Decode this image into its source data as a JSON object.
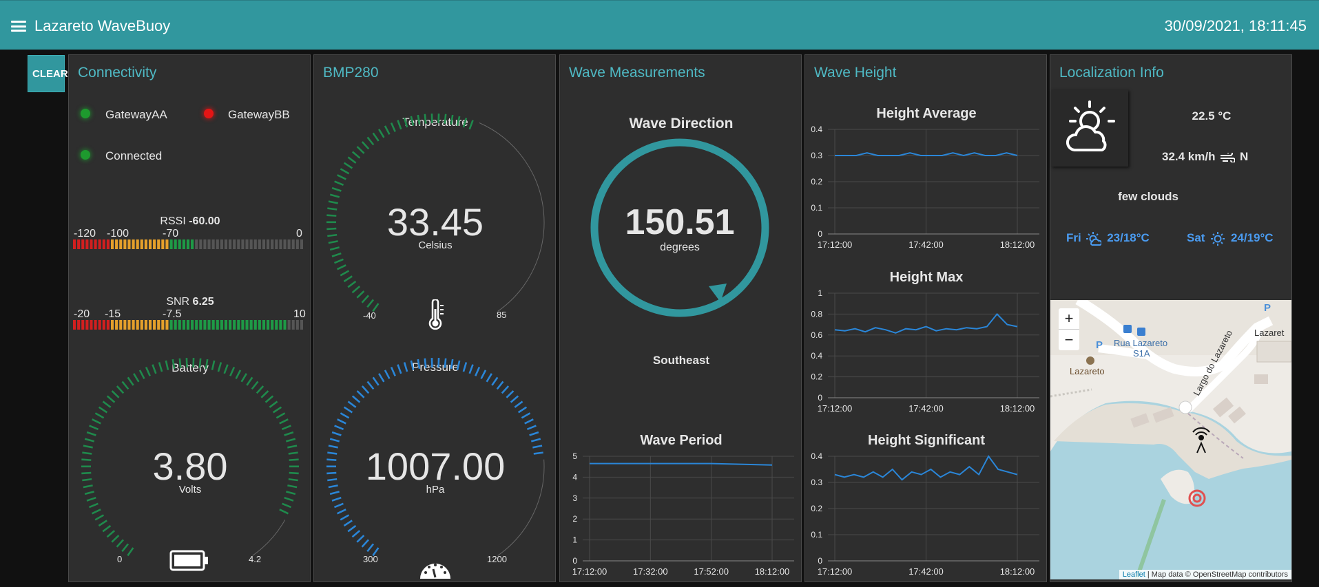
{
  "header": {
    "title": "Lazareto WaveBuoy",
    "datetime": "30/09/2021, 18:11:45"
  },
  "clear_button": "CLEAR",
  "connectivity": {
    "title": "Connectivity",
    "gateways": [
      {
        "name": "GatewayAA",
        "status_color": "#1e9a2e"
      },
      {
        "name": "GatewayBB",
        "status_color": "#e41515"
      },
      {
        "name": "Connected",
        "status_color": "#1e9a2e"
      }
    ],
    "rssi": {
      "label": "RSSI",
      "value": "-60.00",
      "ticks": [
        "-120",
        "-100",
        "-70",
        "0"
      ]
    },
    "snr": {
      "label": "SNR",
      "value": "6.25",
      "ticks": [
        "-20",
        "-15",
        "-7.5",
        "10"
      ]
    },
    "battery": {
      "label": "Battery",
      "value": "3.80",
      "unit": "Volts",
      "min": "0",
      "max": "4.2",
      "level": 0.905
    }
  },
  "bmp280": {
    "title": "BMP280",
    "temperature": {
      "label": "Temperature",
      "value": "33.45",
      "unit": "Celsius",
      "min": "-40",
      "max": "85",
      "level": 0.58
    },
    "pressure": {
      "label": "Pressure",
      "value": "1007.00",
      "unit": "hPa",
      "min": "300",
      "max": "1200",
      "level": 0.786
    }
  },
  "wave_measurements": {
    "title": "Wave Measurements",
    "direction": {
      "label": "Wave Direction",
      "value": "150.51",
      "unit": "degrees",
      "cardinal": "Southeast"
    },
    "period_chart": {
      "title": "Wave Period",
      "y_ticks": [
        "0",
        "1",
        "2",
        "3",
        "4",
        "5"
      ],
      "x_ticks": [
        "17:12:00",
        "17:32:00",
        "17:52:00",
        "18:12:00"
      ]
    }
  },
  "wave_height": {
    "title": "Wave Height",
    "average_chart": {
      "title": "Height Average",
      "y_ticks": [
        "0",
        "0.1",
        "0.2",
        "0.3",
        "0.4"
      ],
      "x_ticks": [
        "17:12:00",
        "17:42:00",
        "18:12:00"
      ]
    },
    "max_chart": {
      "title": "Height Max",
      "y_ticks": [
        "0",
        "0.2",
        "0.4",
        "0.6",
        "0.8",
        "1"
      ],
      "x_ticks": [
        "17:12:00",
        "17:42:00",
        "18:12:00"
      ]
    },
    "significant_chart": {
      "title": "Height Significant",
      "y_ticks": [
        "0",
        "0.1",
        "0.2",
        "0.3",
        "0.4"
      ],
      "x_ticks": [
        "17:12:00",
        "17:42:00",
        "18:12:00"
      ]
    }
  },
  "localization": {
    "title": "Localization Info",
    "weather_icon": "partly-cloudy-icon",
    "temperature": "22.5 °C",
    "wind": "32.4 km/h",
    "wind_direction": "N",
    "condition": "few clouds",
    "forecast": [
      {
        "day": "Fri",
        "icon": "sun-cloud-icon",
        "temp": "23/18°C"
      },
      {
        "day": "Sat",
        "icon": "sun-icon",
        "temp": "24/19°C"
      }
    ],
    "map": {
      "zoom_in": "+",
      "zoom_out": "−",
      "labels": [
        "Rua Lazareto",
        "S1A",
        "Lazareto",
        "Largo do Lazareto",
        "Lazaret"
      ],
      "attribution_link": "Leaflet",
      "attribution_text": " | Map data © OpenStreetMap contributors"
    }
  },
  "chart_data": [
    {
      "type": "line",
      "title": "Wave Period",
      "x": [
        "17:12:00",
        "17:32:00",
        "17:52:00",
        "18:12:00"
      ],
      "series": [
        {
          "values": [
            4.65,
            4.65,
            4.65,
            4.58
          ]
        }
      ],
      "ylim": [
        0,
        5
      ]
    },
    {
      "type": "line",
      "title": "Height Average",
      "x": [
        "17:12:00",
        "17:42:00",
        "18:12:00"
      ],
      "series": [
        {
          "values": [
            0.3,
            0.3,
            0.3,
            0.31,
            0.3,
            0.3,
            0.3,
            0.31,
            0.3,
            0.3,
            0.3,
            0.31,
            0.3,
            0.31,
            0.3,
            0.3,
            0.31,
            0.3
          ]
        }
      ],
      "ylim": [
        0,
        0.4
      ]
    },
    {
      "type": "line",
      "title": "Height Max",
      "x": [
        "17:12:00",
        "17:42:00",
        "18:12:00"
      ],
      "series": [
        {
          "values": [
            0.65,
            0.64,
            0.66,
            0.63,
            0.67,
            0.65,
            0.62,
            0.66,
            0.65,
            0.68,
            0.64,
            0.66,
            0.65,
            0.67,
            0.66,
            0.68,
            0.8,
            0.7,
            0.68
          ]
        }
      ],
      "ylim": [
        0,
        1
      ]
    },
    {
      "type": "line",
      "title": "Height Significant",
      "x": [
        "17:12:00",
        "17:42:00",
        "18:12:00"
      ],
      "series": [
        {
          "values": [
            0.33,
            0.32,
            0.33,
            0.32,
            0.34,
            0.32,
            0.35,
            0.31,
            0.34,
            0.33,
            0.35,
            0.32,
            0.34,
            0.33,
            0.36,
            0.33,
            0.4,
            0.35,
            0.34,
            0.33
          ]
        }
      ],
      "ylim": [
        0,
        0.4
      ]
    }
  ]
}
